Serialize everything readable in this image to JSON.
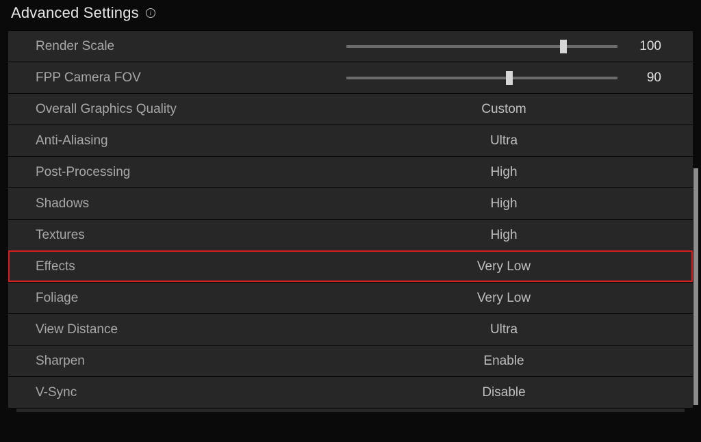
{
  "title": "Advanced Settings",
  "settings": {
    "renderScale": {
      "label": "Render Scale",
      "value": 100,
      "min": 0,
      "max": 120,
      "thumbPercent": 80
    },
    "fppCameraFov": {
      "label": "FPP Camera FOV",
      "value": 90,
      "min": 0,
      "max": 120,
      "thumbPercent": 60
    },
    "overallGraphics": {
      "label": "Overall Graphics Quality",
      "value": "Custom"
    },
    "antiAliasing": {
      "label": "Anti-Aliasing",
      "value": "Ultra"
    },
    "postProcessing": {
      "label": "Post-Processing",
      "value": "High"
    },
    "shadows": {
      "label": "Shadows",
      "value": "High"
    },
    "textures": {
      "label": "Textures",
      "value": "High"
    },
    "effects": {
      "label": "Effects",
      "value": "Very Low",
      "highlighted": true
    },
    "foliage": {
      "label": "Foliage",
      "value": "Very Low"
    },
    "viewDistance": {
      "label": "View Distance",
      "value": "Ultra"
    },
    "sharpen": {
      "label": "Sharpen",
      "value": "Enable"
    },
    "vsync": {
      "label": "V-Sync",
      "value": "Disable"
    }
  },
  "highlightColor": "#d81d21"
}
